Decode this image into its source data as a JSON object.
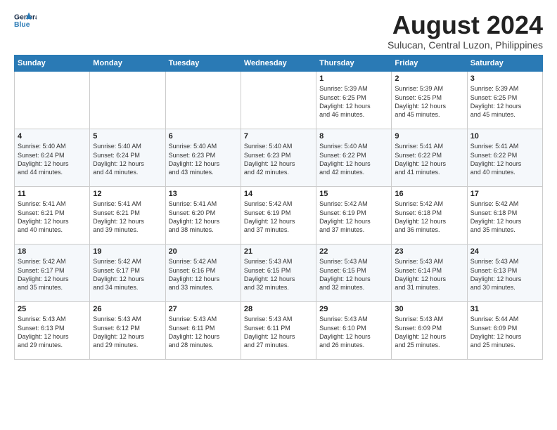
{
  "logo": {
    "line1": "General",
    "line2": "Blue"
  },
  "title": "August 2024",
  "subtitle": "Sulucan, Central Luzon, Philippines",
  "weekdays": [
    "Sunday",
    "Monday",
    "Tuesday",
    "Wednesday",
    "Thursday",
    "Friday",
    "Saturday"
  ],
  "weeks": [
    [
      {
        "day": "",
        "info": ""
      },
      {
        "day": "",
        "info": ""
      },
      {
        "day": "",
        "info": ""
      },
      {
        "day": "",
        "info": ""
      },
      {
        "day": "1",
        "info": "Sunrise: 5:39 AM\nSunset: 6:25 PM\nDaylight: 12 hours\nand 46 minutes."
      },
      {
        "day": "2",
        "info": "Sunrise: 5:39 AM\nSunset: 6:25 PM\nDaylight: 12 hours\nand 45 minutes."
      },
      {
        "day": "3",
        "info": "Sunrise: 5:39 AM\nSunset: 6:25 PM\nDaylight: 12 hours\nand 45 minutes."
      }
    ],
    [
      {
        "day": "4",
        "info": "Sunrise: 5:40 AM\nSunset: 6:24 PM\nDaylight: 12 hours\nand 44 minutes."
      },
      {
        "day": "5",
        "info": "Sunrise: 5:40 AM\nSunset: 6:24 PM\nDaylight: 12 hours\nand 44 minutes."
      },
      {
        "day": "6",
        "info": "Sunrise: 5:40 AM\nSunset: 6:23 PM\nDaylight: 12 hours\nand 43 minutes."
      },
      {
        "day": "7",
        "info": "Sunrise: 5:40 AM\nSunset: 6:23 PM\nDaylight: 12 hours\nand 42 minutes."
      },
      {
        "day": "8",
        "info": "Sunrise: 5:40 AM\nSunset: 6:22 PM\nDaylight: 12 hours\nand 42 minutes."
      },
      {
        "day": "9",
        "info": "Sunrise: 5:41 AM\nSunset: 6:22 PM\nDaylight: 12 hours\nand 41 minutes."
      },
      {
        "day": "10",
        "info": "Sunrise: 5:41 AM\nSunset: 6:22 PM\nDaylight: 12 hours\nand 40 minutes."
      }
    ],
    [
      {
        "day": "11",
        "info": "Sunrise: 5:41 AM\nSunset: 6:21 PM\nDaylight: 12 hours\nand 40 minutes."
      },
      {
        "day": "12",
        "info": "Sunrise: 5:41 AM\nSunset: 6:21 PM\nDaylight: 12 hours\nand 39 minutes."
      },
      {
        "day": "13",
        "info": "Sunrise: 5:41 AM\nSunset: 6:20 PM\nDaylight: 12 hours\nand 38 minutes."
      },
      {
        "day": "14",
        "info": "Sunrise: 5:42 AM\nSunset: 6:19 PM\nDaylight: 12 hours\nand 37 minutes."
      },
      {
        "day": "15",
        "info": "Sunrise: 5:42 AM\nSunset: 6:19 PM\nDaylight: 12 hours\nand 37 minutes."
      },
      {
        "day": "16",
        "info": "Sunrise: 5:42 AM\nSunset: 6:18 PM\nDaylight: 12 hours\nand 36 minutes."
      },
      {
        "day": "17",
        "info": "Sunrise: 5:42 AM\nSunset: 6:18 PM\nDaylight: 12 hours\nand 35 minutes."
      }
    ],
    [
      {
        "day": "18",
        "info": "Sunrise: 5:42 AM\nSunset: 6:17 PM\nDaylight: 12 hours\nand 35 minutes."
      },
      {
        "day": "19",
        "info": "Sunrise: 5:42 AM\nSunset: 6:17 PM\nDaylight: 12 hours\nand 34 minutes."
      },
      {
        "day": "20",
        "info": "Sunrise: 5:42 AM\nSunset: 6:16 PM\nDaylight: 12 hours\nand 33 minutes."
      },
      {
        "day": "21",
        "info": "Sunrise: 5:43 AM\nSunset: 6:15 PM\nDaylight: 12 hours\nand 32 minutes."
      },
      {
        "day": "22",
        "info": "Sunrise: 5:43 AM\nSunset: 6:15 PM\nDaylight: 12 hours\nand 32 minutes."
      },
      {
        "day": "23",
        "info": "Sunrise: 5:43 AM\nSunset: 6:14 PM\nDaylight: 12 hours\nand 31 minutes."
      },
      {
        "day": "24",
        "info": "Sunrise: 5:43 AM\nSunset: 6:13 PM\nDaylight: 12 hours\nand 30 minutes."
      }
    ],
    [
      {
        "day": "25",
        "info": "Sunrise: 5:43 AM\nSunset: 6:13 PM\nDaylight: 12 hours\nand 29 minutes."
      },
      {
        "day": "26",
        "info": "Sunrise: 5:43 AM\nSunset: 6:12 PM\nDaylight: 12 hours\nand 29 minutes."
      },
      {
        "day": "27",
        "info": "Sunrise: 5:43 AM\nSunset: 6:11 PM\nDaylight: 12 hours\nand 28 minutes."
      },
      {
        "day": "28",
        "info": "Sunrise: 5:43 AM\nSunset: 6:11 PM\nDaylight: 12 hours\nand 27 minutes."
      },
      {
        "day": "29",
        "info": "Sunrise: 5:43 AM\nSunset: 6:10 PM\nDaylight: 12 hours\nand 26 minutes."
      },
      {
        "day": "30",
        "info": "Sunrise: 5:43 AM\nSunset: 6:09 PM\nDaylight: 12 hours\nand 25 minutes."
      },
      {
        "day": "31",
        "info": "Sunrise: 5:44 AM\nSunset: 6:09 PM\nDaylight: 12 hours\nand 25 minutes."
      }
    ]
  ]
}
